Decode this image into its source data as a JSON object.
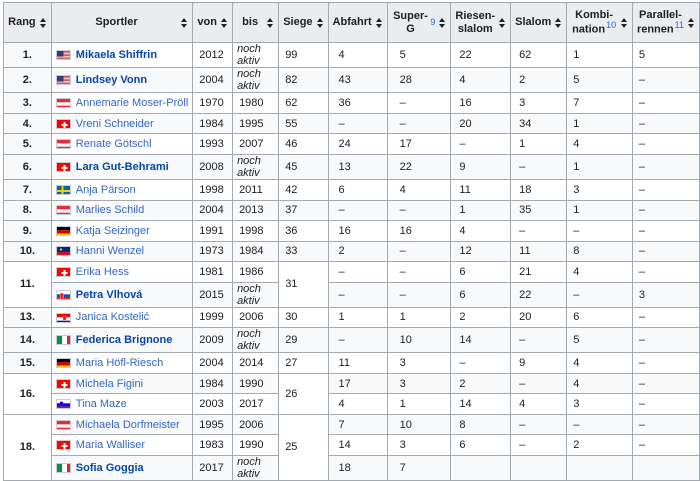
{
  "headers": {
    "rang": "Rang",
    "sportler": "Sportler",
    "von": "von",
    "bis": "bis",
    "siege": "Siege",
    "abfahrt": "Abfahrt",
    "superg": "Super-G",
    "superg_ref": "9",
    "riesenslalom_1": "Riesen-",
    "riesenslalom_2": "slalom",
    "slalom": "Slalom",
    "kombi_1": "Kombi-",
    "kombi_2": "nation",
    "kombi_ref": "10",
    "parallel_1": "Parallel-",
    "parallel_2": "rennen",
    "parallel_ref": "11"
  },
  "colors": {
    "header_bg": "#eaecf0",
    "border": "#a2a9b1",
    "link": "#3366cc",
    "link_bold": "#0645ad"
  },
  "rows": [
    {
      "rang": "1.",
      "flag": "usa",
      "name": "Mikaela Shiffrin",
      "bold": true,
      "von": "2012",
      "bis": "noch aktiv",
      "siege": "99",
      "abfahrt": "4",
      "superg": "5",
      "rs": "22",
      "slalom": "62",
      "kombi": "1",
      "parallel": "5"
    },
    {
      "rang": "2.",
      "flag": "usa",
      "name": "Lindsey Vonn",
      "bold": true,
      "von": "2004",
      "bis": "noch aktiv",
      "siege": "82",
      "abfahrt": "43",
      "superg": "28",
      "rs": "4",
      "slalom": "2",
      "kombi": "5",
      "parallel": "–"
    },
    {
      "rang": "3.",
      "flag": "aut",
      "name": "Annemarie Moser-Pröll",
      "bold": false,
      "von": "1970",
      "bis": "1980",
      "siege": "62",
      "abfahrt": "36",
      "superg": "–",
      "rs": "16",
      "slalom": "3",
      "kombi": "7",
      "parallel": "–"
    },
    {
      "rang": "4.",
      "flag": "sui",
      "name": "Vreni Schneider",
      "bold": false,
      "von": "1984",
      "bis": "1995",
      "siege": "55",
      "abfahrt": "–",
      "superg": "–",
      "rs": "20",
      "slalom": "34",
      "kombi": "1",
      "parallel": "–"
    },
    {
      "rang": "5.",
      "flag": "aut",
      "name": "Renate Götschl",
      "bold": false,
      "von": "1993",
      "bis": "2007",
      "siege": "46",
      "abfahrt": "24",
      "superg": "17",
      "rs": "–",
      "slalom": "1",
      "kombi": "4",
      "parallel": "–"
    },
    {
      "rang": "6.",
      "flag": "sui",
      "name": "Lara Gut-Behrami",
      "bold": true,
      "von": "2008",
      "bis": "noch aktiv",
      "siege": "45",
      "abfahrt": "13",
      "superg": "22",
      "rs": "9",
      "slalom": "–",
      "kombi": "1",
      "parallel": "–"
    },
    {
      "rang": "7.",
      "flag": "swe",
      "name": "Anja Pärson",
      "bold": false,
      "von": "1998",
      "bis": "2011",
      "siege": "42",
      "abfahrt": "6",
      "superg": "4",
      "rs": "11",
      "slalom": "18",
      "kombi": "3",
      "parallel": "–"
    },
    {
      "rang": "8.",
      "flag": "aut",
      "name": "Marlies Schild",
      "bold": false,
      "von": "2004",
      "bis": "2013",
      "siege": "37",
      "abfahrt": "–",
      "superg": "–",
      "rs": "1",
      "slalom": "35",
      "kombi": "1",
      "parallel": "–"
    },
    {
      "rang": "9.",
      "flag": "ger",
      "name": "Katja Seizinger",
      "bold": false,
      "von": "1991",
      "bis": "1998",
      "siege": "36",
      "abfahrt": "16",
      "superg": "16",
      "rs": "4",
      "slalom": "–",
      "kombi": "–",
      "parallel": "–"
    },
    {
      "rang": "10.",
      "flag": "lie",
      "name": "Hanni Wenzel",
      "bold": false,
      "von": "1973",
      "bis": "1984",
      "siege": "33",
      "abfahrt": "2",
      "superg": "–",
      "rs": "12",
      "slalom": "11",
      "kombi": "8",
      "parallel": "–"
    },
    {
      "rang": "11.",
      "rang_span": 2,
      "flag": "sui",
      "name": "Erika Hess",
      "bold": false,
      "von": "1981",
      "bis": "1986",
      "siege": "31",
      "siege_span": 2,
      "abfahrt": "–",
      "superg": "–",
      "rs": "6",
      "slalom": "21",
      "kombi": "4",
      "parallel": "–"
    },
    {
      "rang": null,
      "flag": "svk",
      "name": "Petra Vlhová",
      "bold": true,
      "von": "2015",
      "bis": "noch aktiv",
      "siege": null,
      "abfahrt": "–",
      "superg": "–",
      "rs": "6",
      "slalom": "22",
      "kombi": "–",
      "parallel": "3"
    },
    {
      "rang": "13.",
      "flag": "cro",
      "name": "Janica Kostelić",
      "bold": false,
      "von": "1999",
      "bis": "2006",
      "siege": "30",
      "abfahrt": "1",
      "superg": "1",
      "rs": "2",
      "slalom": "20",
      "kombi": "6",
      "parallel": "–"
    },
    {
      "rang": "14.",
      "flag": "ita",
      "name": "Federica Brignone",
      "bold": true,
      "von": "2009",
      "bis": "noch aktiv",
      "siege": "29",
      "abfahrt": "–",
      "superg": "10",
      "rs": "14",
      "slalom": "–",
      "kombi": "5",
      "parallel": "–"
    },
    {
      "rang": "15.",
      "flag": "ger",
      "name": "Maria Höfl-Riesch",
      "bold": false,
      "von": "2004",
      "bis": "2014",
      "siege": "27",
      "abfahrt": "11",
      "superg": "3",
      "rs": "–",
      "slalom": "9",
      "kombi": "4",
      "parallel": "–"
    },
    {
      "rang": "16.",
      "rang_span": 2,
      "flag": "sui",
      "name": "Michela Figini",
      "bold": false,
      "von": "1984",
      "bis": "1990",
      "siege": "26",
      "siege_span": 2,
      "abfahrt": "17",
      "superg": "3",
      "rs": "2",
      "slalom": "–",
      "kombi": "4",
      "parallel": "–"
    },
    {
      "rang": null,
      "flag": "slo",
      "name": "Tina Maze",
      "bold": false,
      "von": "2003",
      "bis": "2017",
      "siege": null,
      "abfahrt": "4",
      "superg": "1",
      "rs": "14",
      "slalom": "4",
      "kombi": "3",
      "parallel": "–"
    },
    {
      "rang": "18.",
      "rang_span": 3,
      "flag": "aut",
      "name": "Michaela Dorfmeister",
      "bold": false,
      "von": "1995",
      "bis": "2006",
      "siege": "25",
      "siege_span": 3,
      "abfahrt": "7",
      "superg": "10",
      "rs": "8",
      "slalom": "–",
      "kombi": "–",
      "parallel": "–"
    },
    {
      "rang": null,
      "flag": "sui",
      "name": "Maria Walliser",
      "bold": false,
      "von": "1983",
      "bis": "1990",
      "siege": null,
      "abfahrt": "14",
      "superg": "3",
      "rs": "6",
      "slalom": "–",
      "kombi": "2",
      "parallel": "–"
    },
    {
      "rang": null,
      "flag": "ita",
      "name": "Sofia Goggia",
      "bold": true,
      "von": "2017",
      "bis": "noch aktiv",
      "siege": null,
      "abfahrt": "18",
      "superg": "7",
      "rs": "",
      "slalom": "",
      "kombi": "",
      "parallel": ""
    }
  ]
}
